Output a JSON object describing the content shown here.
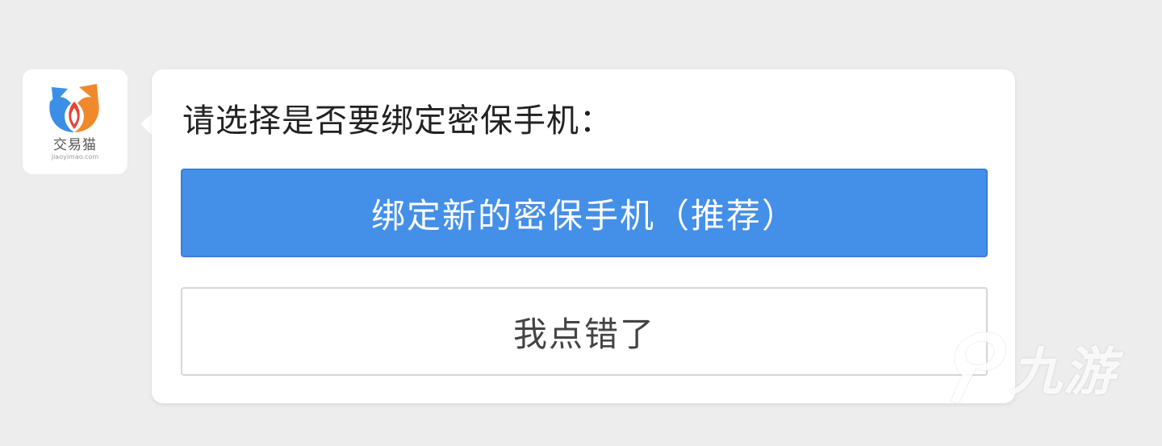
{
  "avatar": {
    "brand_cn": "交易猫",
    "brand_en": "jiaoyimao.com"
  },
  "dialog": {
    "question": "请选择是否要绑定密保手机：",
    "primary_button": "绑定新的密保手机（推荐）",
    "secondary_button": "我点错了"
  },
  "watermark": {
    "text": "九游"
  },
  "colors": {
    "background": "#ededed",
    "primary_button": "#448fe8",
    "logo_blue": "#3b8fe6",
    "logo_orange": "#f0892b"
  }
}
